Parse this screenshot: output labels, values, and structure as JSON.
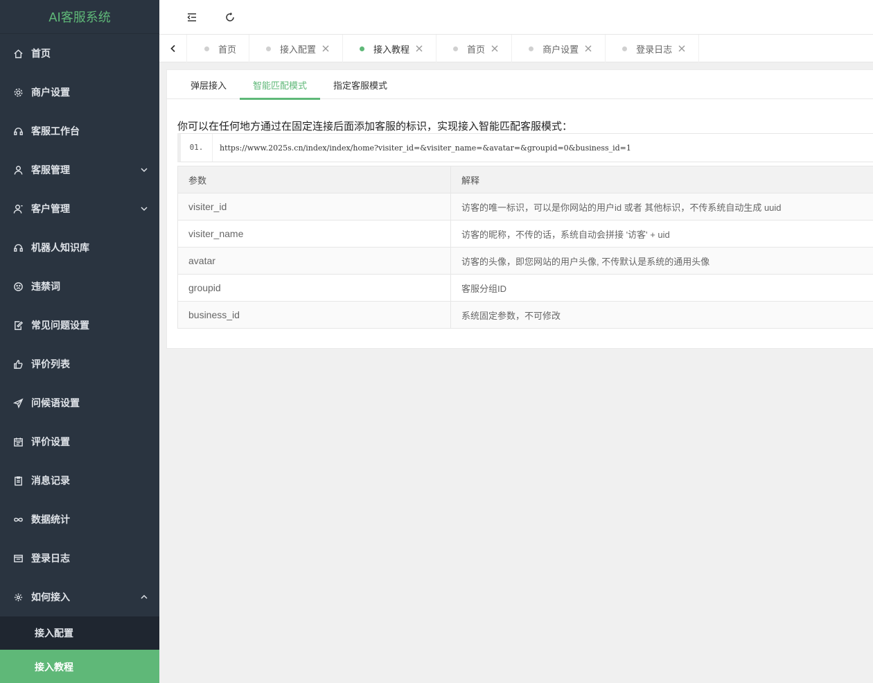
{
  "app": {
    "title": "AI客服系统"
  },
  "sidebar": {
    "items": [
      {
        "label": "首页",
        "icon": "home-icon"
      },
      {
        "label": "商户设置",
        "icon": "gear-icon"
      },
      {
        "label": "客服工作台",
        "icon": "headset-icon"
      },
      {
        "label": "客服管理",
        "icon": "user-icon"
      },
      {
        "label": "客户管理",
        "icon": "customer-icon"
      },
      {
        "label": "机器人知识库",
        "icon": "robot-icon"
      },
      {
        "label": "违禁词",
        "icon": "frown-icon"
      },
      {
        "label": "常见问题设置",
        "icon": "edit-doc-icon"
      },
      {
        "label": "评价列表",
        "icon": "thumbs-up-icon"
      },
      {
        "label": "问候语设置",
        "icon": "send-icon"
      },
      {
        "label": "评价设置",
        "icon": "calendar-icon"
      },
      {
        "label": "消息记录",
        "icon": "clipboard-icon"
      },
      {
        "label": "数据统计",
        "icon": "infinity-icon"
      },
      {
        "label": "登录日志",
        "icon": "window-icon"
      },
      {
        "label": "如何接入",
        "icon": "puzzle-icon"
      }
    ],
    "submenu": [
      {
        "label": "接入配置"
      },
      {
        "label": "接入教程"
      }
    ]
  },
  "tabs": [
    {
      "label": "首页"
    },
    {
      "label": "接入配置"
    },
    {
      "label": "接入教程"
    },
    {
      "label": "首页"
    },
    {
      "label": "商户设置"
    },
    {
      "label": "登录日志"
    }
  ],
  "content": {
    "subtabs": [
      "弹层接入",
      "智能匹配模式",
      "指定客服模式"
    ],
    "description": "你可以在任何地方通过在固定连接后面添加客服的标识，实现接入智能匹配客服模式：",
    "code": {
      "line_number": "01.",
      "text": "https://www.2025s.cn/index/index/home?visiter_id=&visiter_name=&avatar=&groupid=0&business_id=1"
    },
    "table": {
      "headers": [
        "参数",
        "解释"
      ],
      "rows": [
        [
          "visiter_id",
          "访客的唯一标识，可以是你网站的用户id 或者 其他标识，不传系统自动生成 uuid"
        ],
        [
          "visiter_name",
          "访客的昵称，不传的话，系统自动会拼接 '访客' + uid"
        ],
        [
          "avatar",
          "访客的头像，即您网站的用户头像, 不传默认是系统的通用头像"
        ],
        [
          "groupid",
          "客服分组ID"
        ],
        [
          "business_id",
          "系统固定参数，不可修改"
        ]
      ]
    }
  },
  "colors": {
    "accent": "#5fb878",
    "sidebar_bg": "#2a3440"
  }
}
